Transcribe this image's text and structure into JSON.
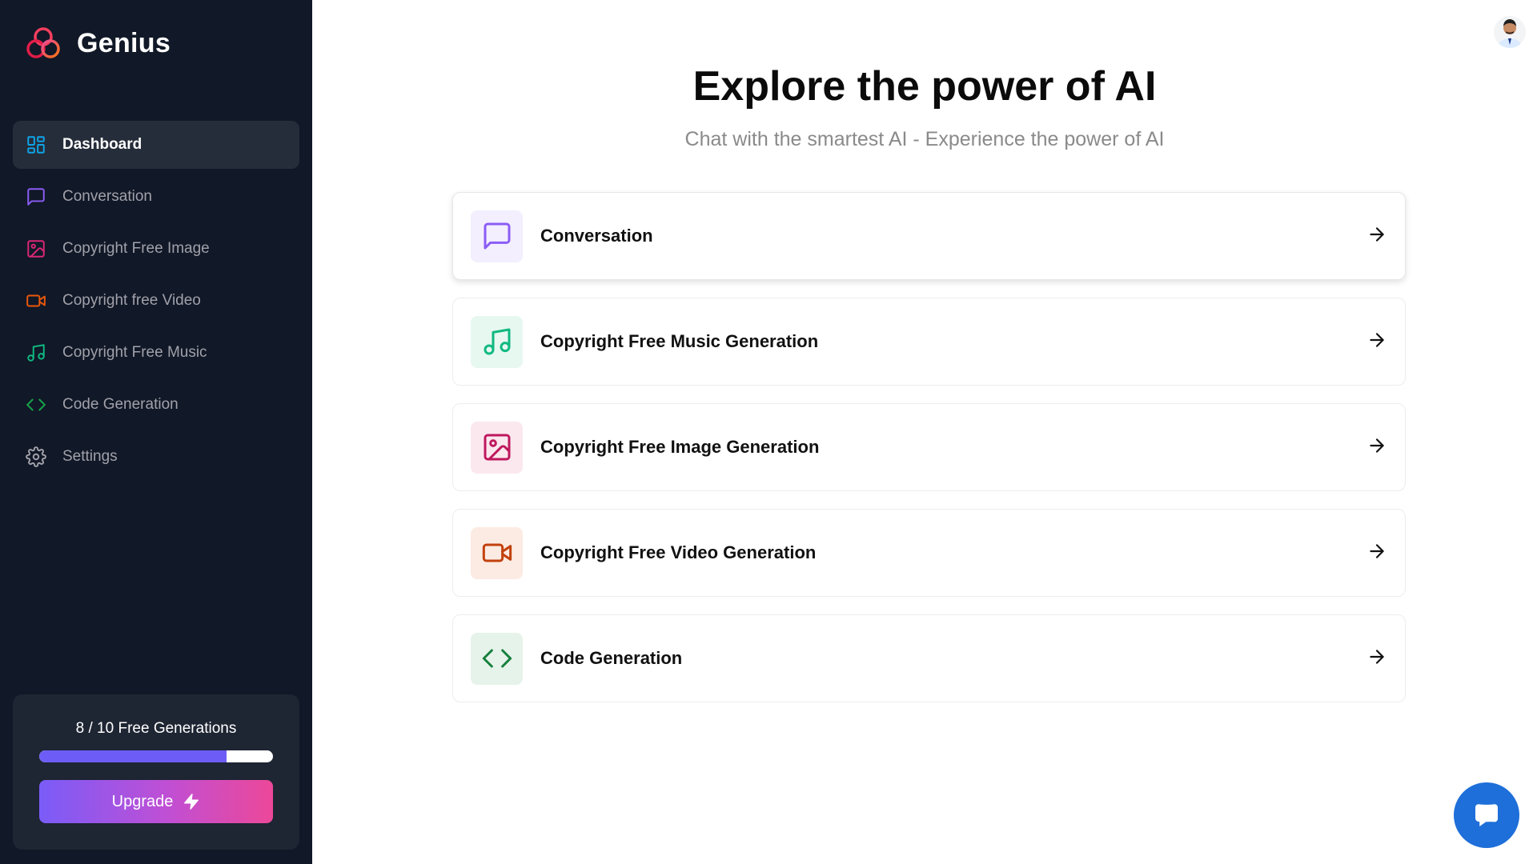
{
  "brand": {
    "name": "Genius",
    "logo_icon": "rings-logo-icon"
  },
  "sidebar": {
    "items": [
      {
        "label": "Dashboard",
        "icon": "layout-dashboard-icon",
        "color": "#0ea5e9",
        "active": true
      },
      {
        "label": "Conversation",
        "icon": "message-square-icon",
        "color": "#8b5cf6",
        "active": false
      },
      {
        "label": "Copyright Free Image",
        "icon": "image-icon",
        "color": "#db2777",
        "active": false
      },
      {
        "label": "Copyright free Video",
        "icon": "video-icon",
        "color": "#ea580c",
        "active": false
      },
      {
        "label": "Copyright Free Music",
        "icon": "music-icon",
        "color": "#10b981",
        "active": false
      },
      {
        "label": "Code Generation",
        "icon": "code-icon",
        "color": "#16a34a",
        "active": false
      },
      {
        "label": "Settings",
        "icon": "settings-icon",
        "color": "#a1a1aa",
        "active": false
      }
    ],
    "usage": {
      "text": "8 / 10 Free Generations",
      "used": 8,
      "limit": 10
    },
    "upgrade_label": "Upgrade",
    "upgrade_icon": "zap-icon"
  },
  "main": {
    "title": "Explore the power of AI",
    "subtitle": "Chat with the smartest AI - Experience the power of AI",
    "cards": [
      {
        "label": "Conversation",
        "icon": "message-square-icon",
        "color": "#8b5cf6",
        "bg": "#f3effe"
      },
      {
        "label": "Copyright Free Music Generation",
        "icon": "music-icon",
        "color": "#10b981",
        "bg": "#e7f8f1"
      },
      {
        "label": "Copyright Free Image Generation",
        "icon": "image-icon",
        "color": "#be185d",
        "bg": "#fbe8ef"
      },
      {
        "label": "Copyright Free Video Generation",
        "icon": "video-icon",
        "color": "#c2410c",
        "bg": "#fcebe3"
      },
      {
        "label": "Code Generation",
        "icon": "code-icon",
        "color": "#15803d",
        "bg": "#e6f3ea"
      }
    ],
    "card_arrow_icon": "arrow-right-icon"
  },
  "header": {
    "avatar_icon": "user-avatar"
  },
  "chat_widget": {
    "icon": "chat-icon",
    "color": "#1e6fd9"
  }
}
